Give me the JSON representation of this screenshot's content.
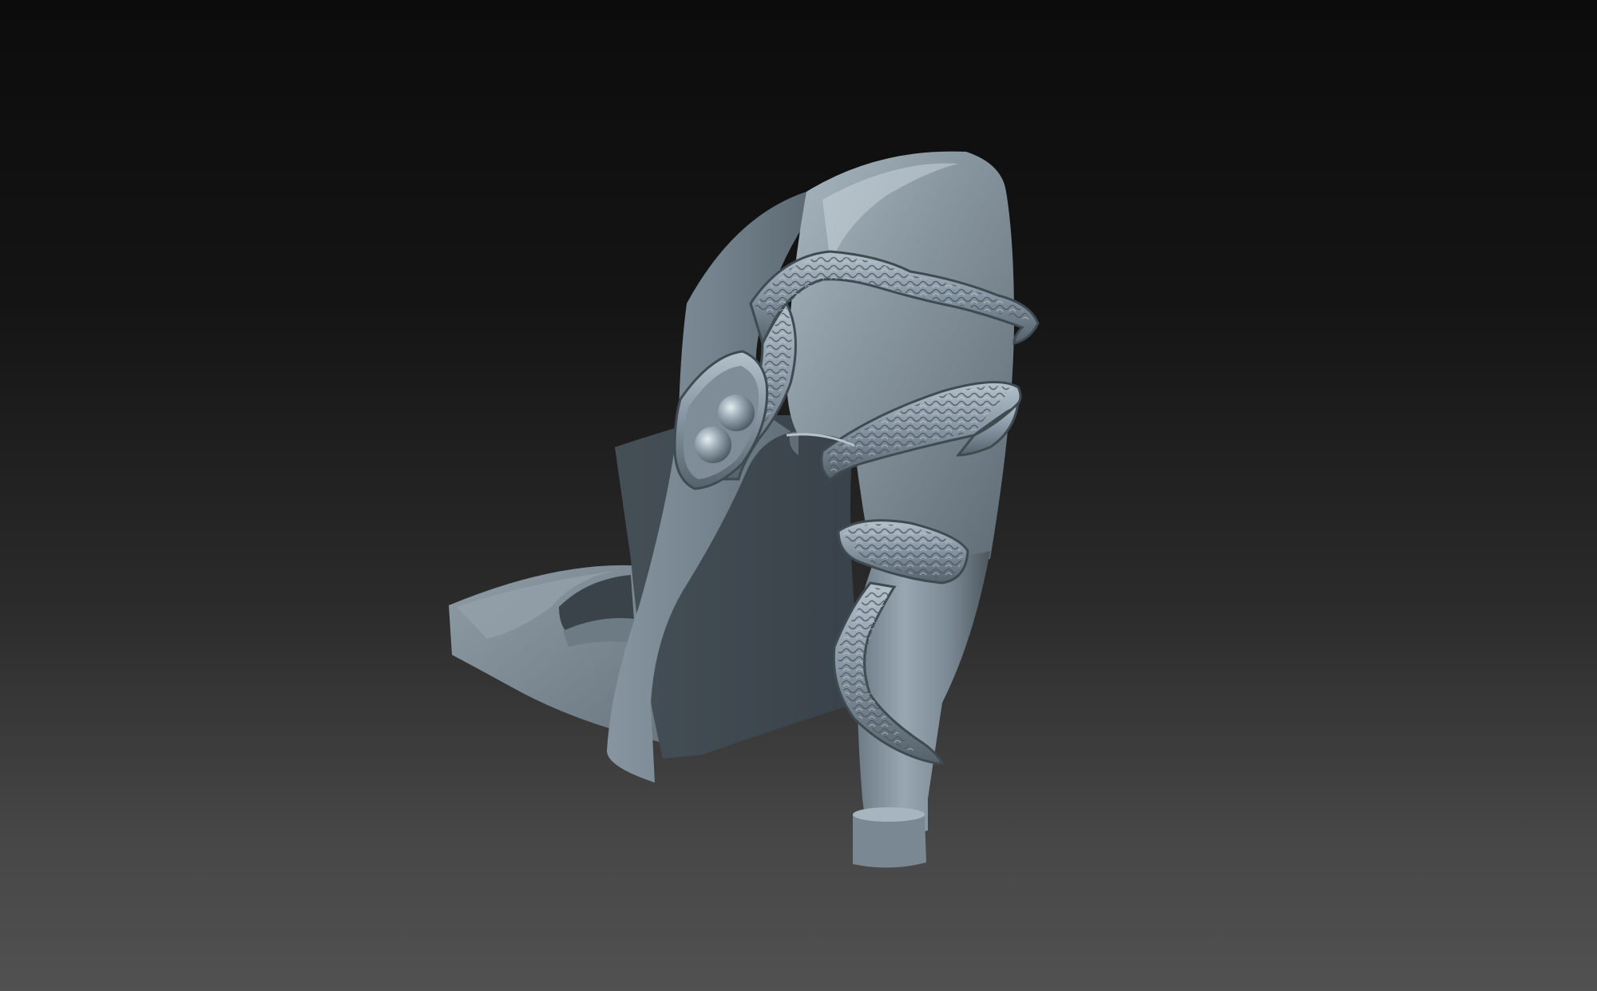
{
  "viewport": {
    "background_top": "#0c0c0c",
    "background_bottom": "#515151"
  },
  "model": {
    "subject": "high-heel-shoe-with-snake-wrapped-heel",
    "material_colors": {
      "highlight": "#b9c6cf",
      "base": "#7d8b95",
      "mid": "#5f6c75",
      "shadow": "#3d464c",
      "deep_shadow": "#2a3035"
    }
  }
}
